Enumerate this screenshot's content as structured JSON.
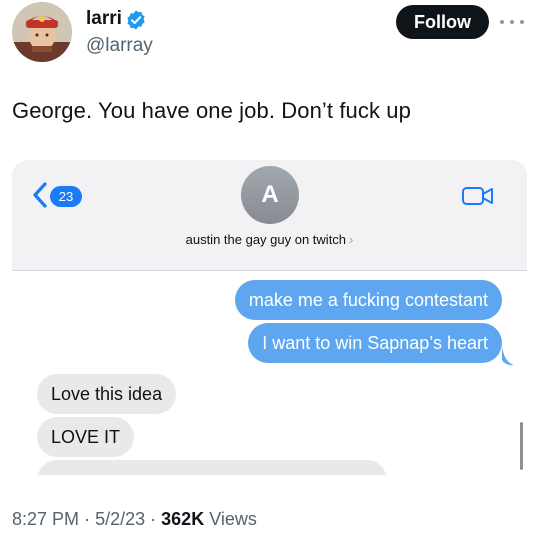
{
  "author": {
    "display_name": "larri",
    "handle": "@larray",
    "verified": true
  },
  "header": {
    "follow_label": "Follow",
    "more_icon": "more-horizontal-icon"
  },
  "tweet": {
    "text": "George. You have one job. Don’t fuck up"
  },
  "imessage": {
    "back_count": "23",
    "contact_initial": "A",
    "contact_name": "austin the gay guy on twitch",
    "contact_chevron": "›",
    "messages": [
      {
        "side": "sent",
        "text": "make me a fucking contestant"
      },
      {
        "side": "sent",
        "text": "I want to win Sapnap’s heart"
      },
      {
        "side": "received",
        "text": "Love this idea"
      },
      {
        "side": "received",
        "text": "LOVE IT"
      }
    ]
  },
  "meta": {
    "time": "8:27 PM",
    "sep1": "·",
    "date": "5/2/23",
    "sep2": "·",
    "views_count": "362K",
    "views_label": "Views"
  },
  "colors": {
    "verified": "#1d9bf0",
    "imessage_blue": "#5ea6ef",
    "received_gray": "#e9e9eb"
  }
}
